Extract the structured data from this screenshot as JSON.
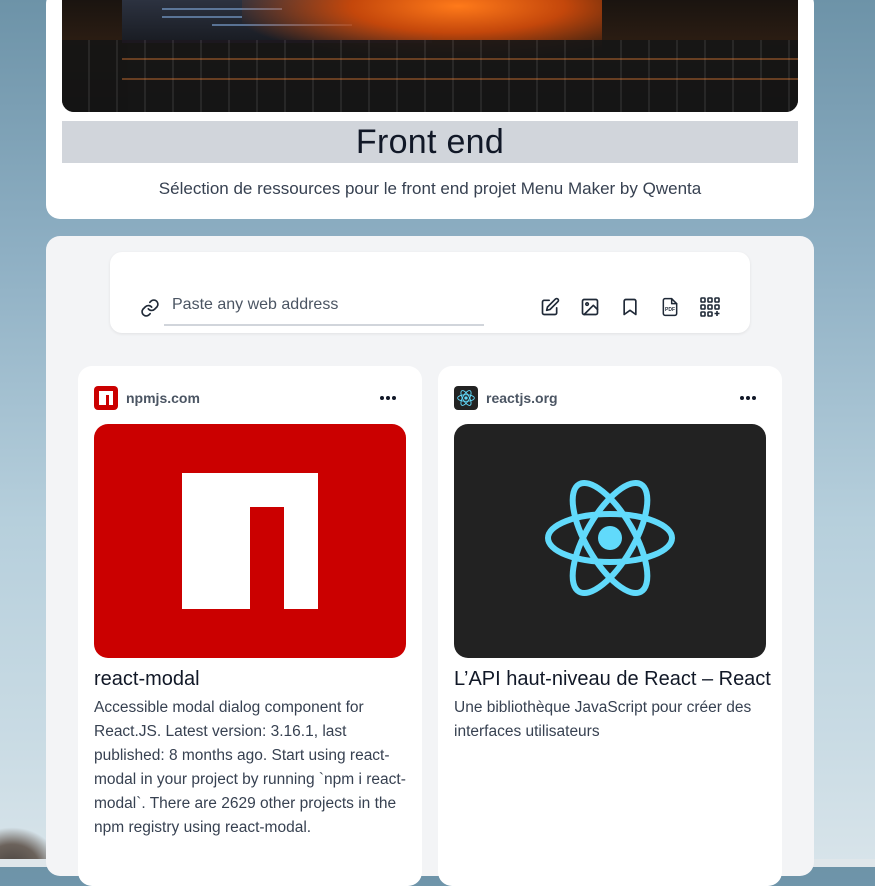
{
  "header": {
    "title": "Front end",
    "subtitle": "Sélection de ressources pour le front end projet Menu Maker by Qwenta"
  },
  "toolbar": {
    "url_placeholder": "Paste any web address",
    "actions": [
      {
        "name": "note-icon",
        "label": "note"
      },
      {
        "name": "image-icon",
        "label": "image"
      },
      {
        "name": "bookmark-icon",
        "label": "bookmark"
      },
      {
        "name": "pdf-icon",
        "label": "PDF"
      },
      {
        "name": "apps-add-icon",
        "label": "more"
      }
    ]
  },
  "cards": [
    {
      "domain": "npmjs.com",
      "title": "react-modal",
      "description": "Accessible modal dialog component for React.JS. Latest version: 3.16.1, last published: 8 months ago. Start using react-modal in your project by running `npm i react-modal`. There are 2629 other projects in the npm registry using react-modal.",
      "brand_color": "#cb0000"
    },
    {
      "domain": "reactjs.org",
      "title": "L’API haut-niveau de React – React",
      "description": "Une bibliothèque JavaScript pour créer des interfaces utilisateurs",
      "brand_color": "#61dafb"
    }
  ]
}
